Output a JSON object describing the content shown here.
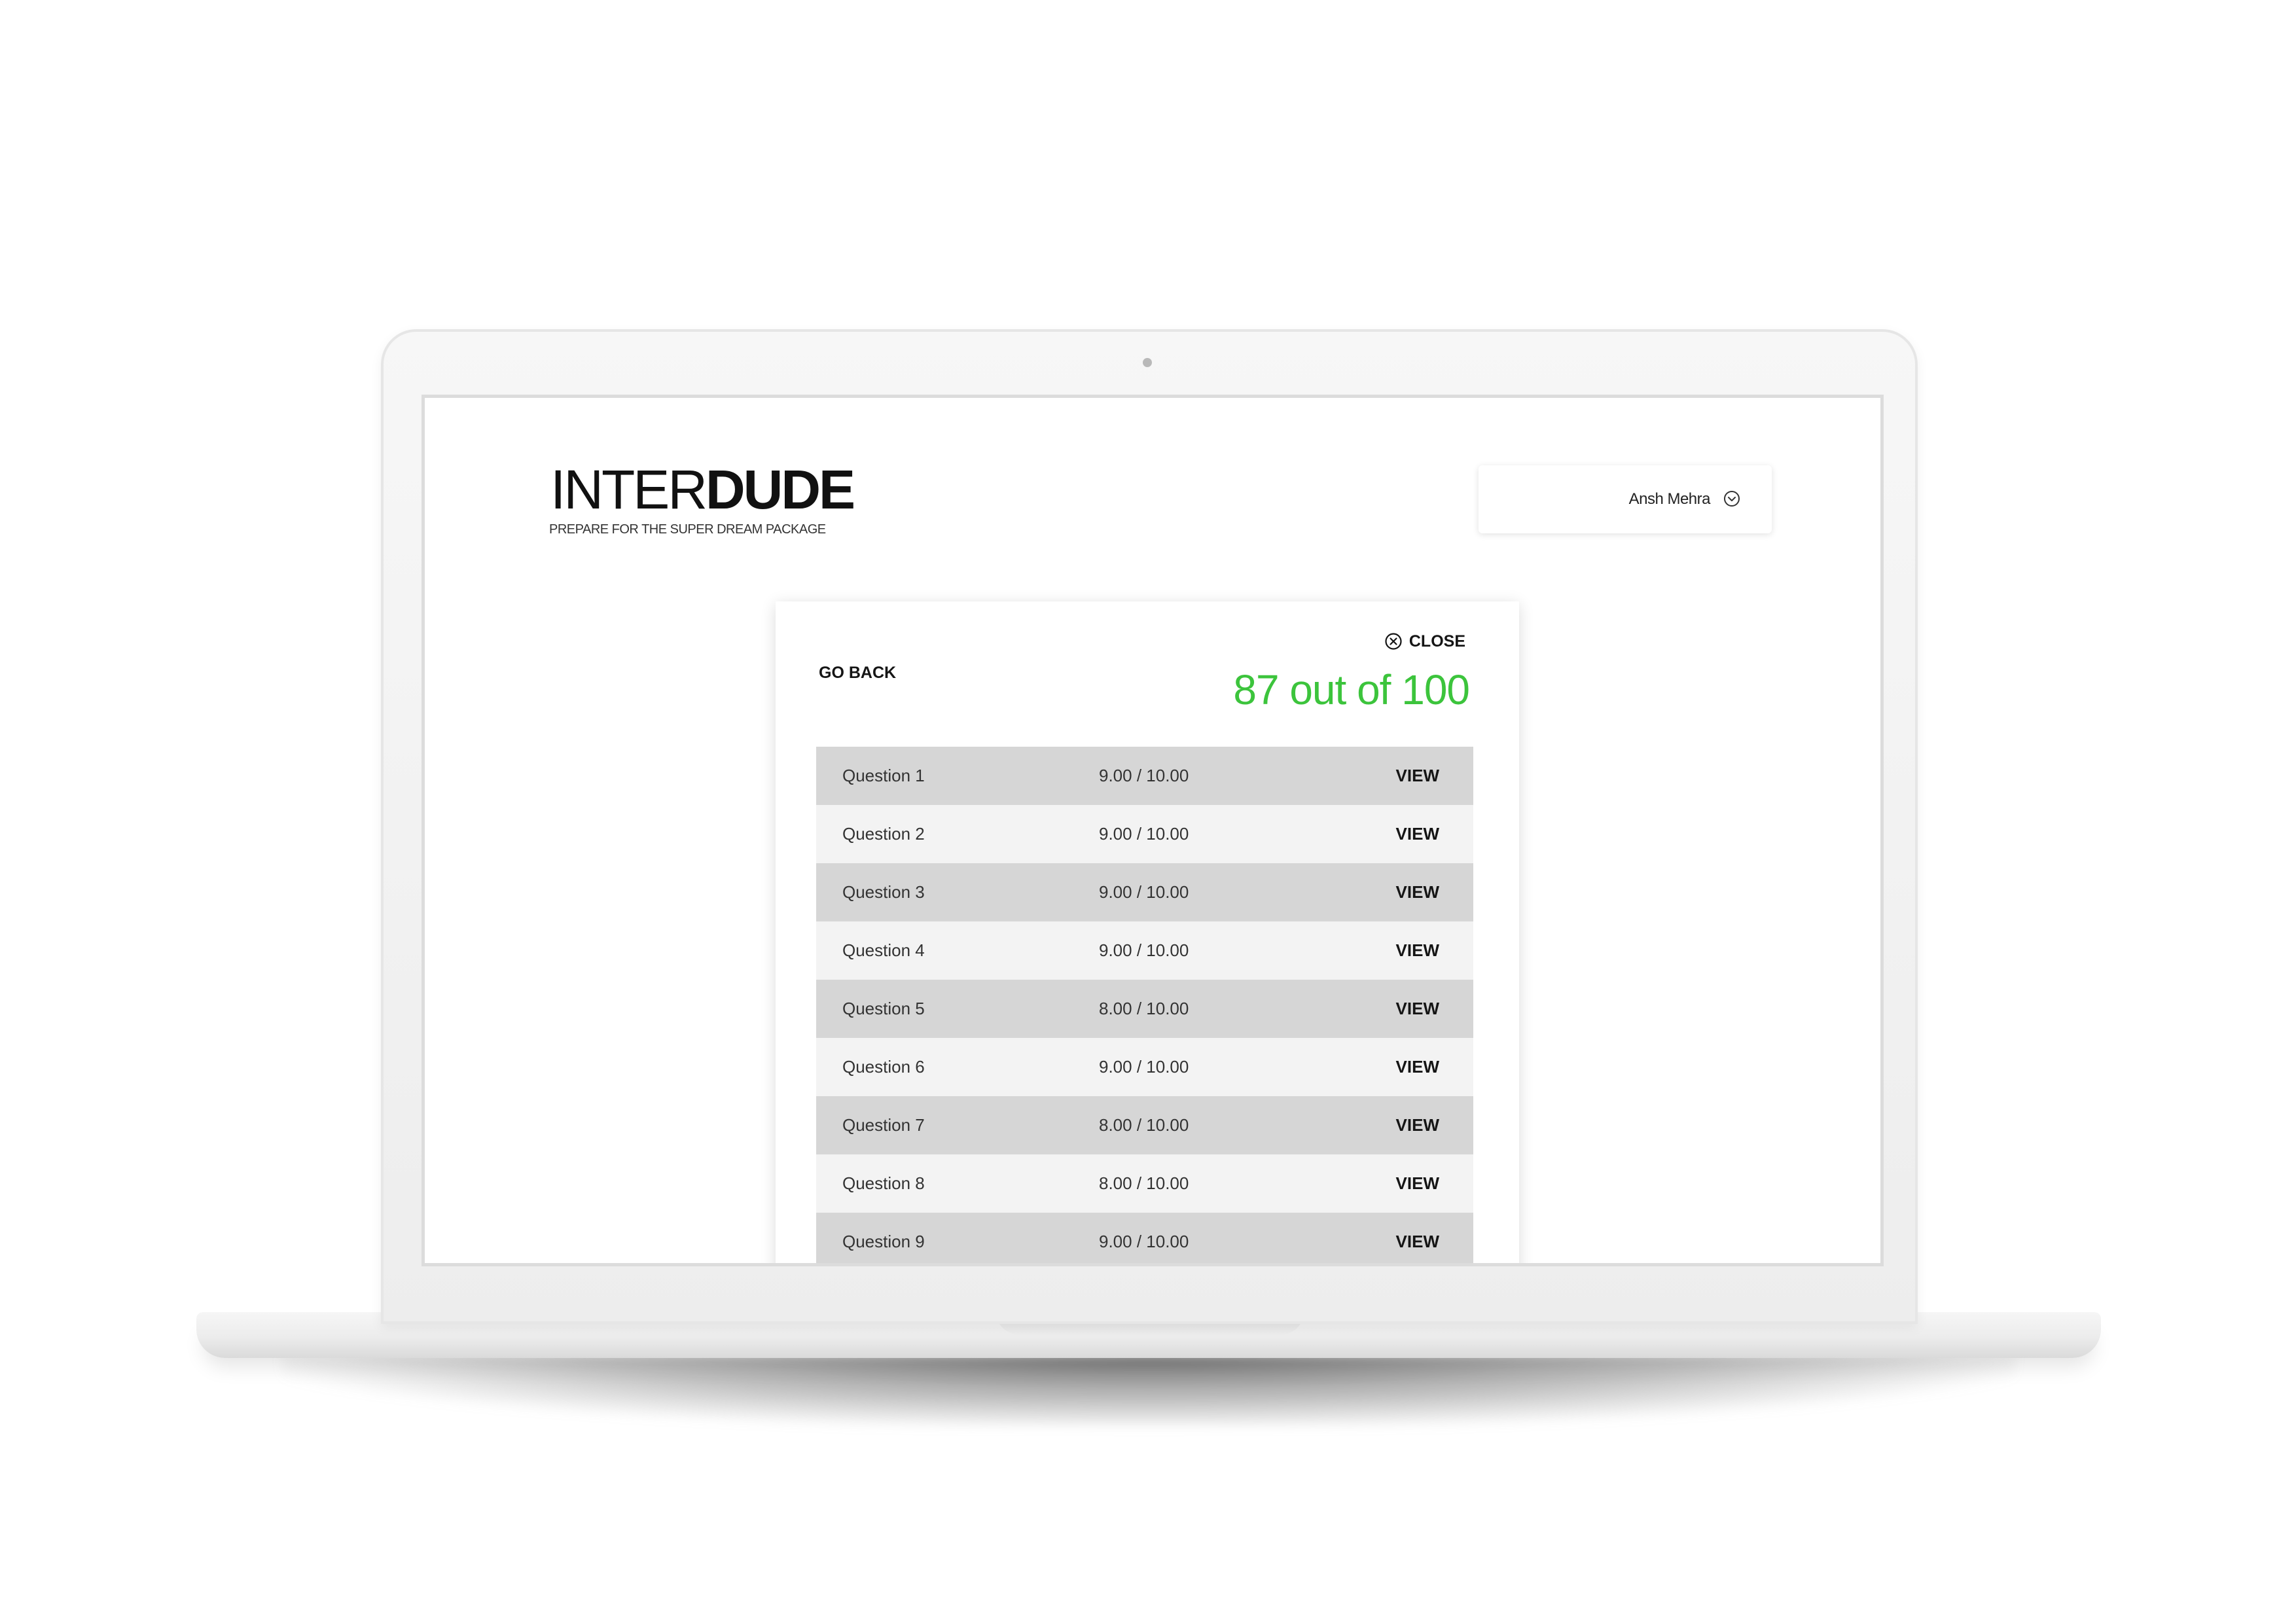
{
  "app": {
    "brand_light": "INTER",
    "brand_bold": "DUDE",
    "tagline": "PREPARE FOR THE SUPER DREAM PACKAGE"
  },
  "user": {
    "name": "Ansh Mehra",
    "menu_icon": "chevron-down-circle-icon"
  },
  "results": {
    "go_back_label": "GO BACK",
    "close_label": "CLOSE",
    "close_icon": "close-circle-icon",
    "score_text": "87 out of 100",
    "score_color": "#3cc43c",
    "questions": [
      {
        "label": "Question 1",
        "score": "9.00 / 10.00",
        "action": "VIEW"
      },
      {
        "label": "Question 2",
        "score": "9.00 / 10.00",
        "action": "VIEW"
      },
      {
        "label": "Question 3",
        "score": "9.00 / 10.00",
        "action": "VIEW"
      },
      {
        "label": "Question 4",
        "score": "9.00 / 10.00",
        "action": "VIEW"
      },
      {
        "label": "Question 5",
        "score": "8.00 / 10.00",
        "action": "VIEW"
      },
      {
        "label": "Question 6",
        "score": "9.00 / 10.00",
        "action": "VIEW"
      },
      {
        "label": "Question 7",
        "score": "8.00 / 10.00",
        "action": "VIEW"
      },
      {
        "label": "Question 8",
        "score": "8.00 / 10.00",
        "action": "VIEW"
      },
      {
        "label": "Question 9",
        "score": "9.00 / 10.00",
        "action": "VIEW"
      }
    ]
  }
}
